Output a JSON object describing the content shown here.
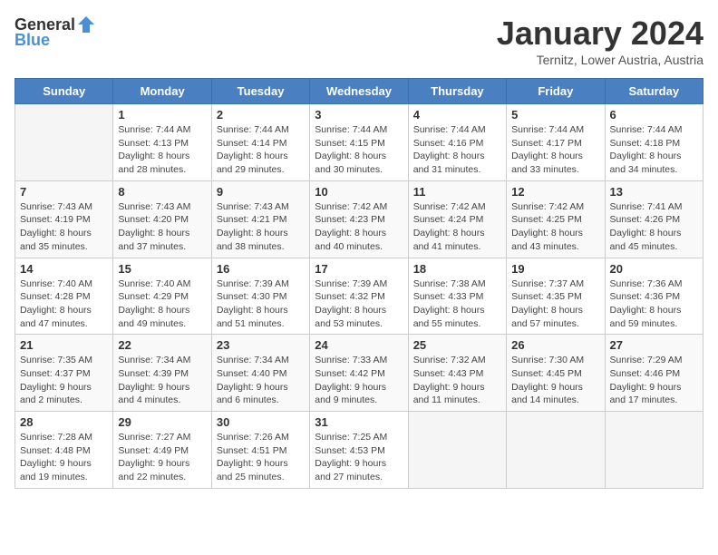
{
  "header": {
    "logo_general": "General",
    "logo_blue": "Blue",
    "month": "January 2024",
    "location": "Ternitz, Lower Austria, Austria"
  },
  "days_of_week": [
    "Sunday",
    "Monday",
    "Tuesday",
    "Wednesday",
    "Thursday",
    "Friday",
    "Saturday"
  ],
  "weeks": [
    [
      {
        "day": "",
        "sunrise": "",
        "sunset": "",
        "daylight": ""
      },
      {
        "day": "1",
        "sunrise": "Sunrise: 7:44 AM",
        "sunset": "Sunset: 4:13 PM",
        "daylight": "Daylight: 8 hours and 28 minutes."
      },
      {
        "day": "2",
        "sunrise": "Sunrise: 7:44 AM",
        "sunset": "Sunset: 4:14 PM",
        "daylight": "Daylight: 8 hours and 29 minutes."
      },
      {
        "day": "3",
        "sunrise": "Sunrise: 7:44 AM",
        "sunset": "Sunset: 4:15 PM",
        "daylight": "Daylight: 8 hours and 30 minutes."
      },
      {
        "day": "4",
        "sunrise": "Sunrise: 7:44 AM",
        "sunset": "Sunset: 4:16 PM",
        "daylight": "Daylight: 8 hours and 31 minutes."
      },
      {
        "day": "5",
        "sunrise": "Sunrise: 7:44 AM",
        "sunset": "Sunset: 4:17 PM",
        "daylight": "Daylight: 8 hours and 33 minutes."
      },
      {
        "day": "6",
        "sunrise": "Sunrise: 7:44 AM",
        "sunset": "Sunset: 4:18 PM",
        "daylight": "Daylight: 8 hours and 34 minutes."
      }
    ],
    [
      {
        "day": "7",
        "sunrise": "Sunrise: 7:43 AM",
        "sunset": "Sunset: 4:19 PM",
        "daylight": "Daylight: 8 hours and 35 minutes."
      },
      {
        "day": "8",
        "sunrise": "Sunrise: 7:43 AM",
        "sunset": "Sunset: 4:20 PM",
        "daylight": "Daylight: 8 hours and 37 minutes."
      },
      {
        "day": "9",
        "sunrise": "Sunrise: 7:43 AM",
        "sunset": "Sunset: 4:21 PM",
        "daylight": "Daylight: 8 hours and 38 minutes."
      },
      {
        "day": "10",
        "sunrise": "Sunrise: 7:42 AM",
        "sunset": "Sunset: 4:23 PM",
        "daylight": "Daylight: 8 hours and 40 minutes."
      },
      {
        "day": "11",
        "sunrise": "Sunrise: 7:42 AM",
        "sunset": "Sunset: 4:24 PM",
        "daylight": "Daylight: 8 hours and 41 minutes."
      },
      {
        "day": "12",
        "sunrise": "Sunrise: 7:42 AM",
        "sunset": "Sunset: 4:25 PM",
        "daylight": "Daylight: 8 hours and 43 minutes."
      },
      {
        "day": "13",
        "sunrise": "Sunrise: 7:41 AM",
        "sunset": "Sunset: 4:26 PM",
        "daylight": "Daylight: 8 hours and 45 minutes."
      }
    ],
    [
      {
        "day": "14",
        "sunrise": "Sunrise: 7:40 AM",
        "sunset": "Sunset: 4:28 PM",
        "daylight": "Daylight: 8 hours and 47 minutes."
      },
      {
        "day": "15",
        "sunrise": "Sunrise: 7:40 AM",
        "sunset": "Sunset: 4:29 PM",
        "daylight": "Daylight: 8 hours and 49 minutes."
      },
      {
        "day": "16",
        "sunrise": "Sunrise: 7:39 AM",
        "sunset": "Sunset: 4:30 PM",
        "daylight": "Daylight: 8 hours and 51 minutes."
      },
      {
        "day": "17",
        "sunrise": "Sunrise: 7:39 AM",
        "sunset": "Sunset: 4:32 PM",
        "daylight": "Daylight: 8 hours and 53 minutes."
      },
      {
        "day": "18",
        "sunrise": "Sunrise: 7:38 AM",
        "sunset": "Sunset: 4:33 PM",
        "daylight": "Daylight: 8 hours and 55 minutes."
      },
      {
        "day": "19",
        "sunrise": "Sunrise: 7:37 AM",
        "sunset": "Sunset: 4:35 PM",
        "daylight": "Daylight: 8 hours and 57 minutes."
      },
      {
        "day": "20",
        "sunrise": "Sunrise: 7:36 AM",
        "sunset": "Sunset: 4:36 PM",
        "daylight": "Daylight: 8 hours and 59 minutes."
      }
    ],
    [
      {
        "day": "21",
        "sunrise": "Sunrise: 7:35 AM",
        "sunset": "Sunset: 4:37 PM",
        "daylight": "Daylight: 9 hours and 2 minutes."
      },
      {
        "day": "22",
        "sunrise": "Sunrise: 7:34 AM",
        "sunset": "Sunset: 4:39 PM",
        "daylight": "Daylight: 9 hours and 4 minutes."
      },
      {
        "day": "23",
        "sunrise": "Sunrise: 7:34 AM",
        "sunset": "Sunset: 4:40 PM",
        "daylight": "Daylight: 9 hours and 6 minutes."
      },
      {
        "day": "24",
        "sunrise": "Sunrise: 7:33 AM",
        "sunset": "Sunset: 4:42 PM",
        "daylight": "Daylight: 9 hours and 9 minutes."
      },
      {
        "day": "25",
        "sunrise": "Sunrise: 7:32 AM",
        "sunset": "Sunset: 4:43 PM",
        "daylight": "Daylight: 9 hours and 11 minutes."
      },
      {
        "day": "26",
        "sunrise": "Sunrise: 7:30 AM",
        "sunset": "Sunset: 4:45 PM",
        "daylight": "Daylight: 9 hours and 14 minutes."
      },
      {
        "day": "27",
        "sunrise": "Sunrise: 7:29 AM",
        "sunset": "Sunset: 4:46 PM",
        "daylight": "Daylight: 9 hours and 17 minutes."
      }
    ],
    [
      {
        "day": "28",
        "sunrise": "Sunrise: 7:28 AM",
        "sunset": "Sunset: 4:48 PM",
        "daylight": "Daylight: 9 hours and 19 minutes."
      },
      {
        "day": "29",
        "sunrise": "Sunrise: 7:27 AM",
        "sunset": "Sunset: 4:49 PM",
        "daylight": "Daylight: 9 hours and 22 minutes."
      },
      {
        "day": "30",
        "sunrise": "Sunrise: 7:26 AM",
        "sunset": "Sunset: 4:51 PM",
        "daylight": "Daylight: 9 hours and 25 minutes."
      },
      {
        "day": "31",
        "sunrise": "Sunrise: 7:25 AM",
        "sunset": "Sunset: 4:53 PM",
        "daylight": "Daylight: 9 hours and 27 minutes."
      },
      {
        "day": "",
        "sunrise": "",
        "sunset": "",
        "daylight": ""
      },
      {
        "day": "",
        "sunrise": "",
        "sunset": "",
        "daylight": ""
      },
      {
        "day": "",
        "sunrise": "",
        "sunset": "",
        "daylight": ""
      }
    ]
  ]
}
